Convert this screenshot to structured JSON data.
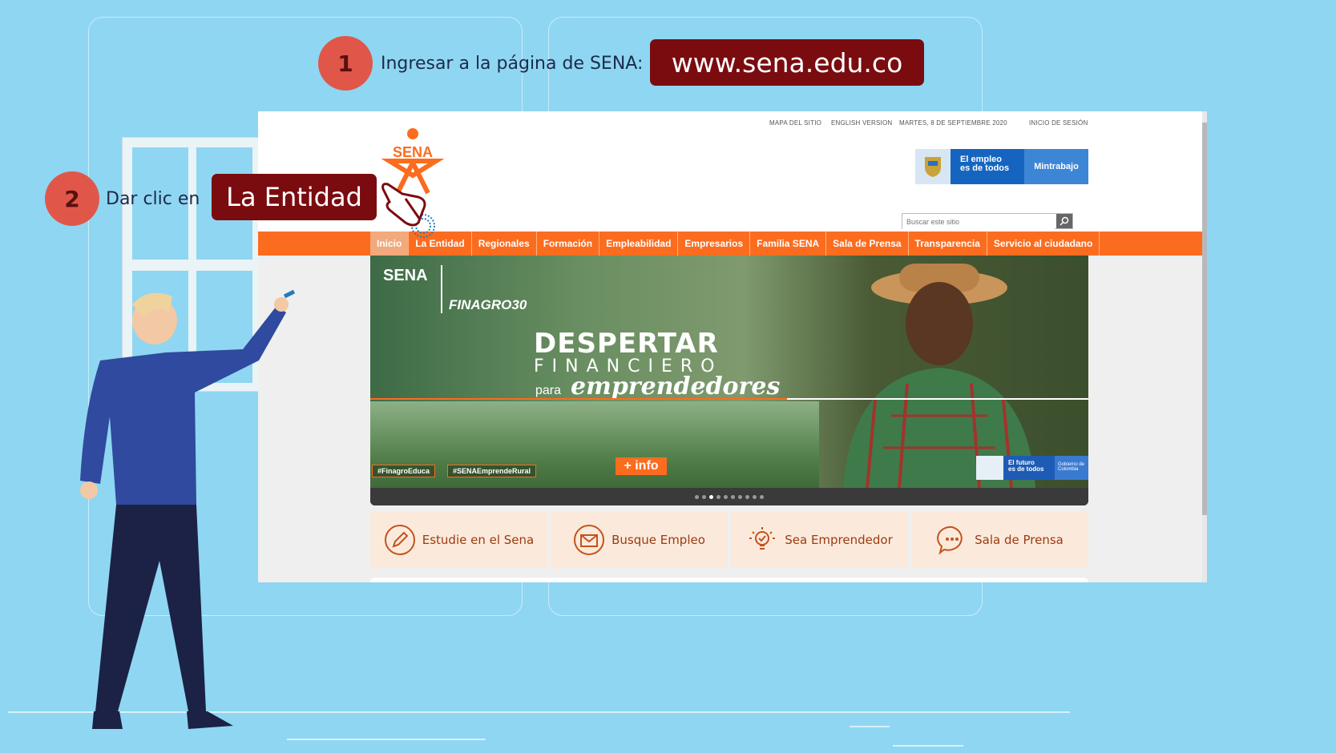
{
  "step1": {
    "number": "1",
    "text": "Ingresar a la página de SENA:",
    "url": "www.sena.edu.co"
  },
  "step2": {
    "number": "2",
    "text": "Dar clic en",
    "target": "La Entidad"
  },
  "site": {
    "utility_links": [
      "MAPA DEL SITIO",
      "ENGLISH VERSION",
      "MARTES, 8 DE SEPTIEMBRE 2020",
      "INICIO DE SESIÓN"
    ],
    "logo_text": "SENA",
    "mintrabajo": {
      "line1": "El empleo",
      "line2": "es de todos",
      "brand": "Mintrabajo"
    },
    "search_placeholder": "Buscar este sitio",
    "nav": [
      "Inicio",
      "La Entidad",
      "Regionales",
      "Formación",
      "Empleabilidad",
      "Empresarios",
      "Familia SENA",
      "Sala de Prensa",
      "Transparencia",
      "Servicio al ciudadano"
    ],
    "nav_active": 0,
    "banner": {
      "brand_sena": "SENA",
      "brand_finagro": "FINAGRO30",
      "headline_1": "DESPERTAR",
      "headline_2": "FINANCIERO",
      "headline_3a": "para",
      "headline_3b": "emprendedores",
      "tags": [
        "#FinagroEduca",
        "#SENAEmprendeRural"
      ],
      "info_button": "+ info",
      "gov_badge_1": "El futuro",
      "gov_badge_2": "es de todos",
      "gov_badge_3": "Gobierno de Colombia",
      "slide_count": 10,
      "slide_active": 2
    },
    "cards": [
      {
        "label": "Estudie en el Sena",
        "icon": "pencil-icon"
      },
      {
        "label": "Busque Empleo",
        "icon": "envelope-icon"
      },
      {
        "label": "Sea Emprendedor",
        "icon": "lightbulb-icon"
      },
      {
        "label": "Sala de Prensa",
        "icon": "chat-bubble-icon"
      }
    ]
  },
  "colors": {
    "background": "#8fd6f2",
    "step_circle": "#e0574a",
    "highlight": "#7a0c10",
    "sena_orange": "#fc6c1f"
  }
}
